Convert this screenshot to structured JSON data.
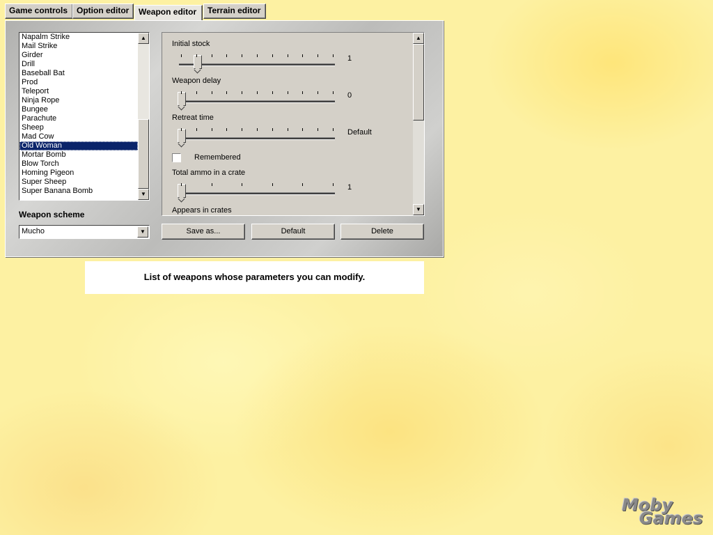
{
  "tabs": [
    {
      "label": "Game controls",
      "active": false
    },
    {
      "label": "Option editor",
      "active": false
    },
    {
      "label": "Weapon editor",
      "active": true
    },
    {
      "label": "Terrain editor",
      "active": false
    }
  ],
  "weapon_list": {
    "items": [
      "Napalm Strike",
      "Mail Strike",
      "Girder",
      "Drill",
      "Baseball Bat",
      "Prod",
      "Teleport",
      "Ninja Rope",
      "Bungee",
      "Parachute",
      "Sheep",
      "Mad Cow",
      "Old Woman",
      "Mortar Bomb",
      "Blow Torch",
      "Homing Pigeon",
      "Super Sheep",
      "Super Banana Bomb"
    ],
    "selected": "Old Woman"
  },
  "scheme": {
    "label": "Weapon scheme",
    "value": "Mucho"
  },
  "params": {
    "initial_stock": {
      "label": "Initial stock",
      "value": "1"
    },
    "weapon_delay": {
      "label": "Weapon delay",
      "value": "0"
    },
    "retreat_time": {
      "label": "Retreat time",
      "value": "Default"
    },
    "remembered": {
      "label": "Remembered",
      "checked": false
    },
    "total_ammo": {
      "label": "Total ammo in a crate",
      "value": "1"
    },
    "appears": {
      "label": "Appears in crates"
    }
  },
  "buttons": {
    "save_as": "Save as...",
    "default": "Default",
    "delete": "Delete"
  },
  "help_text": "List of weapons whose parameters you can modify.",
  "logo": {
    "line1": "Moby",
    "line2": "Games"
  },
  "icons": {
    "scroll_up": "▲",
    "scroll_down": "▼"
  }
}
